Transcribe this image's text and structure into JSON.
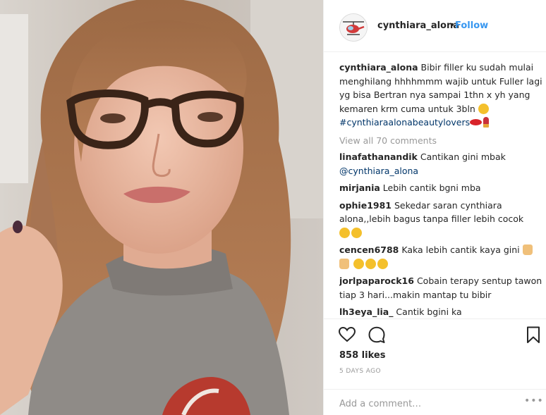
{
  "post": {
    "username": "cynthiara_alona",
    "separator": "•",
    "follow_label": "Follow",
    "caption_user": "cynthiara_alona",
    "caption_text": " Bibir filler ku sudah mulai menghilang hhhhmmm wajib untuk Fuller lagi yg bisa Bertran nya sampai 1thn x yh yang kemaren krm cuma untuk 3bln ",
    "caption_hashtag": "#cynthiaraalonabeautylovers",
    "view_all": "View all 70 comments",
    "likes": "858 likes",
    "date": "5 DAYS AGO",
    "comment_placeholder": "Add a comment…",
    "more_label": "•••"
  },
  "comments": [
    {
      "user": "linafathanandik",
      "text": " Cantikan gini mbak ",
      "mention": "@cynthiara_alona"
    },
    {
      "user": "mirjania",
      "text": " Lebih cantik bgni mba"
    },
    {
      "user": "ophie1981",
      "text": " Sekedar saran cynthiara alona,,lebih bagus tanpa filler lebih cocok"
    },
    {
      "user": "cencen6788",
      "text": " Kaka lebih cantik kaya gini"
    },
    {
      "user": "jorlpaparock16",
      "text": " Cobain terapy sentup tawon tiap 3 hari...makin mantap tu bibir"
    },
    {
      "user": "lh3eya_lia_",
      "text": " Cantik bgini ka"
    }
  ],
  "icons": {
    "heart": "heart-icon",
    "comment": "comment-icon",
    "bookmark": "bookmark-icon",
    "avatar": "helicopter-avatar"
  },
  "colors": {
    "link": "#3897f0",
    "hashtag": "#003569",
    "muted": "#999999",
    "text": "#262626"
  }
}
